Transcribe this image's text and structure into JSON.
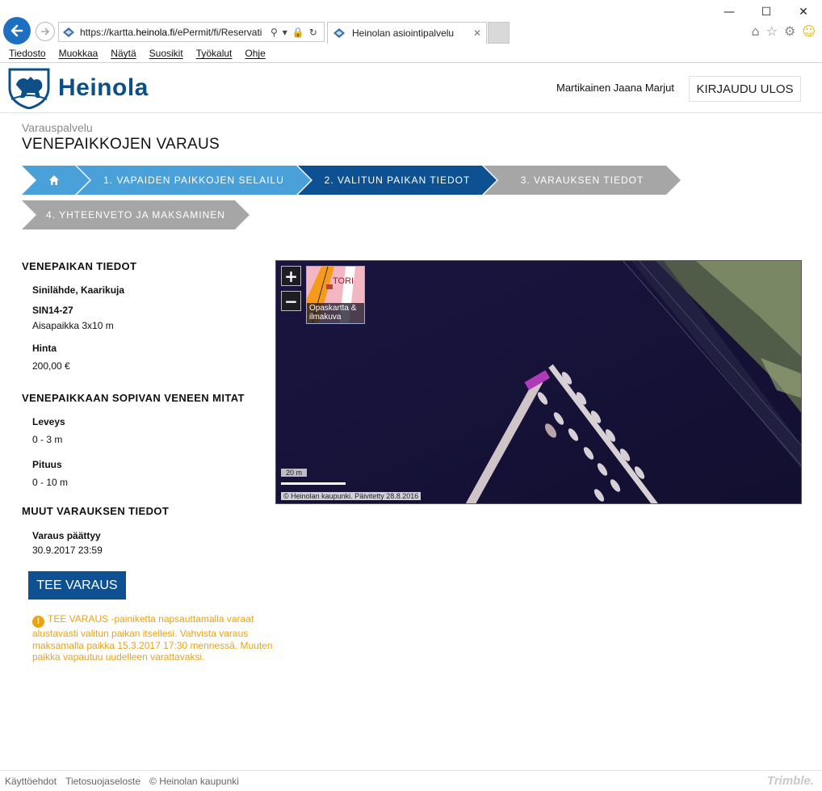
{
  "browser": {
    "url_prefix": "https://kartta.",
    "url_domain": "heinola.fi",
    "url_rest": "/ePermit/fi/Reservati",
    "tab_title": "Heinolan asiointipalvelu",
    "menu": [
      "Tiedosto",
      "Muokkaa",
      "Näytä",
      "Suosikit",
      "Työkalut",
      "Ohje"
    ]
  },
  "header": {
    "logo_text": "Heinola",
    "user_name": "Martikainen Jaana Marjut",
    "logout_label": "KIRJAUDU ULOS"
  },
  "page": {
    "subtitle": "Varauspalvelu",
    "title": "VENEPAIKKOJEN VARAUS"
  },
  "steps": [
    {
      "label": "",
      "state": "done",
      "color": "#4aa0d9"
    },
    {
      "label": "1. VAPAIDEN PAIKKOJEN SELAILU",
      "state": "done",
      "color": "#4aa0d9"
    },
    {
      "label": "2. VALITUN PAIKAN TIEDOT",
      "state": "active",
      "color": "#0d5192"
    },
    {
      "label": "3. VARAUKSEN TIEDOT",
      "state": "todo",
      "color": "#a6a6a6"
    },
    {
      "label": "4. YHTEENVETO JA MAKSAMINEN",
      "state": "todo",
      "color": "#a6a6a6"
    }
  ],
  "details": {
    "section1_title": "VENEPAIKAN TIEDOT",
    "location": "Sinilähde, Kaarikuja",
    "berth_id": "SIN14-27",
    "berth_type": "Aisapaikka 3x10 m",
    "price_label": "Hinta",
    "price_value": "200,00 €",
    "section2_title": "VENEPAIKKAAN SOPIVAN VENEEN MITAT",
    "width_label": "Leveys",
    "width_value": "0 - 3 m",
    "length_label": "Pituus",
    "length_value": "0 - 10 m",
    "section3_title": "MUUT VARAUKSEN TIEDOT",
    "end_label": "Varaus päättyy",
    "end_value": "30.9.2017 23:59"
  },
  "actions": {
    "reserve_label": "TEE VARAUS",
    "notice_text": "TEE VARAUS -painiketta napsauttamalla varaat alustavasti valitun paikan itsellesi. Vahvista varaus maksamalla paikka 15.3.2017 17:30 mennessä. Muuten paikka vapautuu uudelleen varattavaksi."
  },
  "map": {
    "zoom_in": "+",
    "zoom_out": "−",
    "layer_label_1": "Opaskartta &",
    "layer_label_2": "ilmakuva",
    "layer_thumb_text": "TORI",
    "scale_text": "20 m",
    "copyright": "© Heinolan kaupunki. Päivitetty 28.8.2016",
    "selected_color": "#b03ab8"
  },
  "footer": {
    "links": [
      "Käyttöehdot",
      "Tietosuojaseloste"
    ],
    "copyright": "© Heinolan kaupunki",
    "brand": "Trimble."
  }
}
